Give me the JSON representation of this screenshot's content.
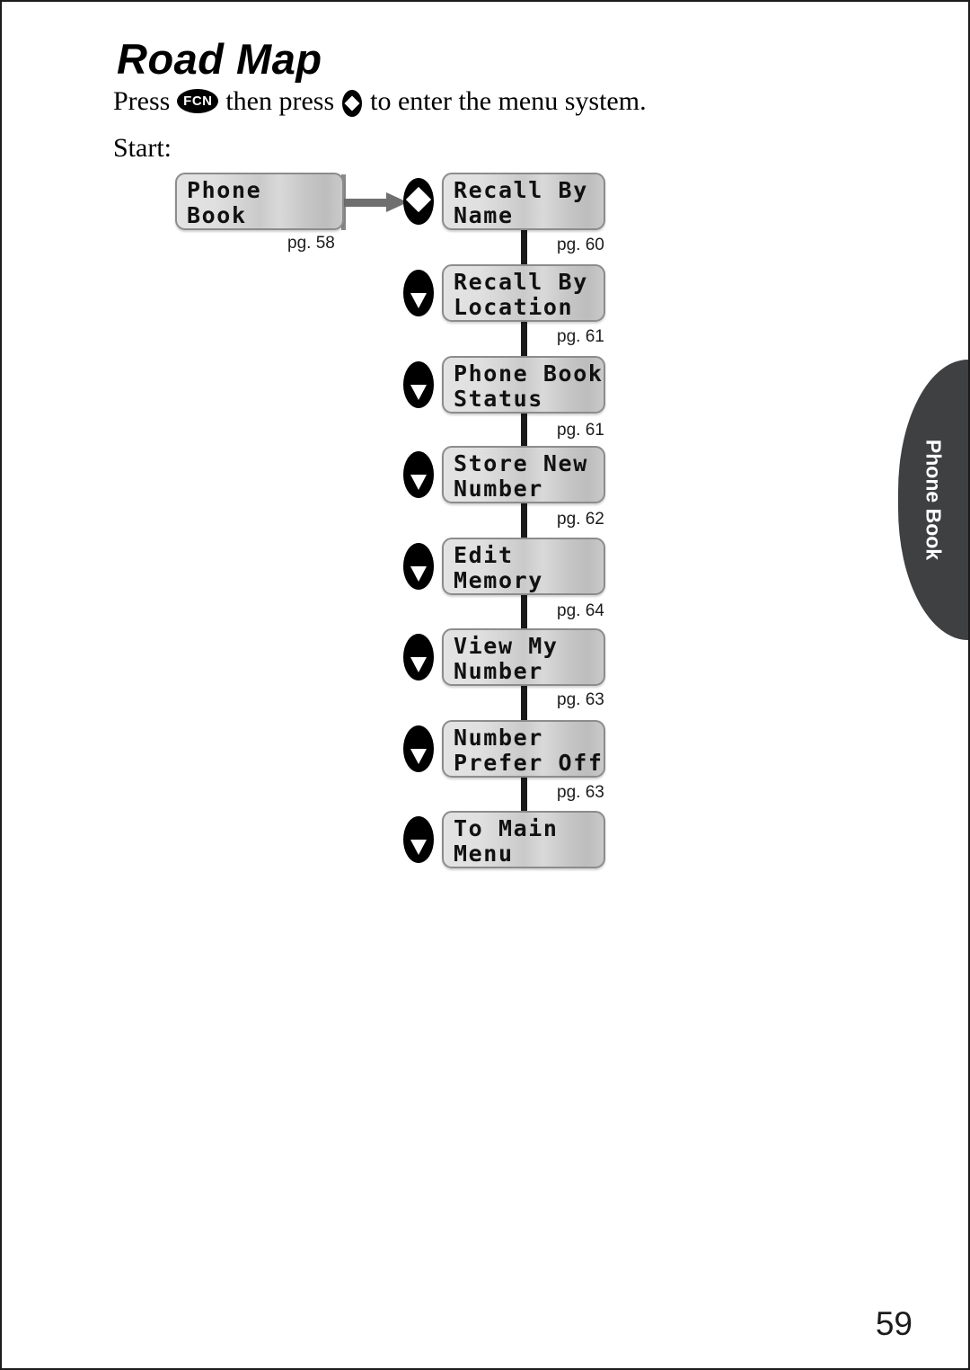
{
  "page": {
    "title": "Road Map",
    "instruction_prefix": "Press",
    "instruction_middle": "then press",
    "instruction_suffix": "to enter the menu system.",
    "fcn_key_label": "FCN",
    "start_label": "Start:",
    "folio": "59",
    "side_tab_label": "Phone Book"
  },
  "start_node": {
    "line1": "Phone",
    "line2": "Book",
    "icon": "book-icon",
    "page_ref": "pg. 58"
  },
  "menu_items": [
    {
      "line1": "Recall By",
      "line2": "Name",
      "icon": "book-icon",
      "page_ref": "pg. 60",
      "key": "diamond"
    },
    {
      "line1": "Recall By",
      "line2": "Location",
      "icon": "book-icon",
      "page_ref": "pg. 61",
      "key": "down"
    },
    {
      "line1": "Phone Book",
      "line2": "Status",
      "icon": "book-icon",
      "page_ref": "pg. 61",
      "key": "down"
    },
    {
      "line1": "Store New",
      "line2": "Number",
      "icon": "book-icon",
      "page_ref": "pg. 62",
      "key": "down"
    },
    {
      "line1": "Edit",
      "line2": "Memory",
      "icon": "book-icon",
      "page_ref": "pg. 64",
      "key": "down"
    },
    {
      "line1": "View My",
      "line2": "Number",
      "icon": "book-icon",
      "page_ref": "pg. 63",
      "key": "down"
    },
    {
      "line1": "Number",
      "line2": "Prefer Off",
      "icon": "book-icon",
      "page_ref": "pg. 63",
      "key": "down"
    },
    {
      "line1": "To Main",
      "line2": "Menu",
      "icon": "book-icon",
      "page_ref": "",
      "key": "down"
    }
  ]
}
